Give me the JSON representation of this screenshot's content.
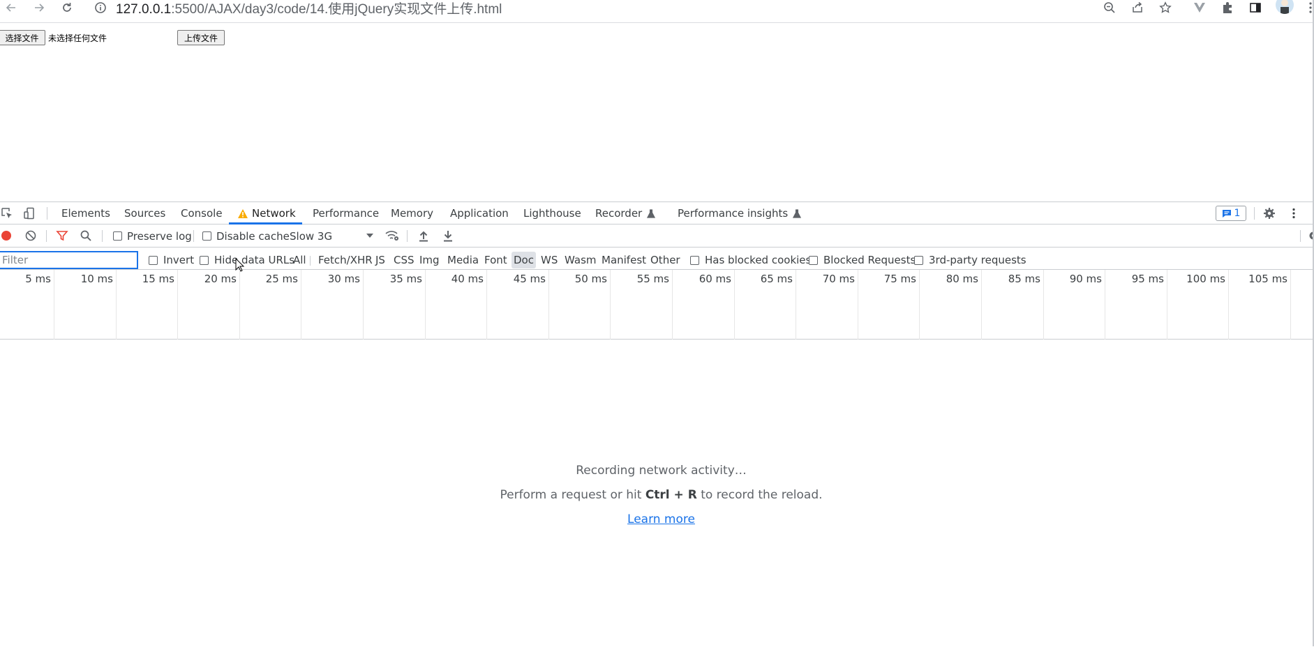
{
  "browser": {
    "url_host": "127.0.0.1",
    "url_path": ":5500/AJAX/day3/code/14.使用jQuery实现文件上传.html"
  },
  "page": {
    "choose_file_label": "选择文件",
    "no_file_text": "未选择任何文件",
    "upload_label": "上传文件"
  },
  "devtools": {
    "tabs": [
      {
        "label": "Elements"
      },
      {
        "label": "Sources"
      },
      {
        "label": "Console"
      },
      {
        "label": "Network"
      },
      {
        "label": "Performance"
      },
      {
        "label": "Memory"
      },
      {
        "label": "Application"
      },
      {
        "label": "Lighthouse"
      },
      {
        "label": "Recorder"
      },
      {
        "label": "Performance insights"
      }
    ],
    "issues_count": "1",
    "toolbar": {
      "preserve_log": "Preserve log",
      "disable_cache": "Disable cache",
      "throttle": "Slow 3G"
    },
    "filter": {
      "placeholder": "Filter",
      "invert": "Invert",
      "hide_data_urls": "Hide data URLs",
      "types": [
        "All",
        "Fetch/XHR",
        "JS",
        "CSS",
        "Img",
        "Media",
        "Font",
        "Doc",
        "WS",
        "Wasm",
        "Manifest",
        "Other"
      ],
      "selected_type": "Doc",
      "has_blocked_cookies": "Has blocked cookies",
      "blocked_requests": "Blocked Requests",
      "third_party": "3rd-party requests"
    },
    "timeline_ticks": [
      "5 ms",
      "10 ms",
      "15 ms",
      "20 ms",
      "25 ms",
      "30 ms",
      "35 ms",
      "40 ms",
      "45 ms",
      "50 ms",
      "55 ms",
      "60 ms",
      "65 ms",
      "70 ms",
      "75 ms",
      "80 ms",
      "85 ms",
      "90 ms",
      "95 ms",
      "100 ms",
      "105 ms"
    ],
    "empty": {
      "line1": "Recording network activity…",
      "line2_pre": "Perform a request or hit ",
      "line2_key": "Ctrl + R",
      "line2_post": " to record the reload.",
      "learn_more": "Learn more"
    }
  },
  "colors": {
    "accent": "#1a73e8",
    "record": "#ea4335",
    "warning": "#f9ab00"
  }
}
